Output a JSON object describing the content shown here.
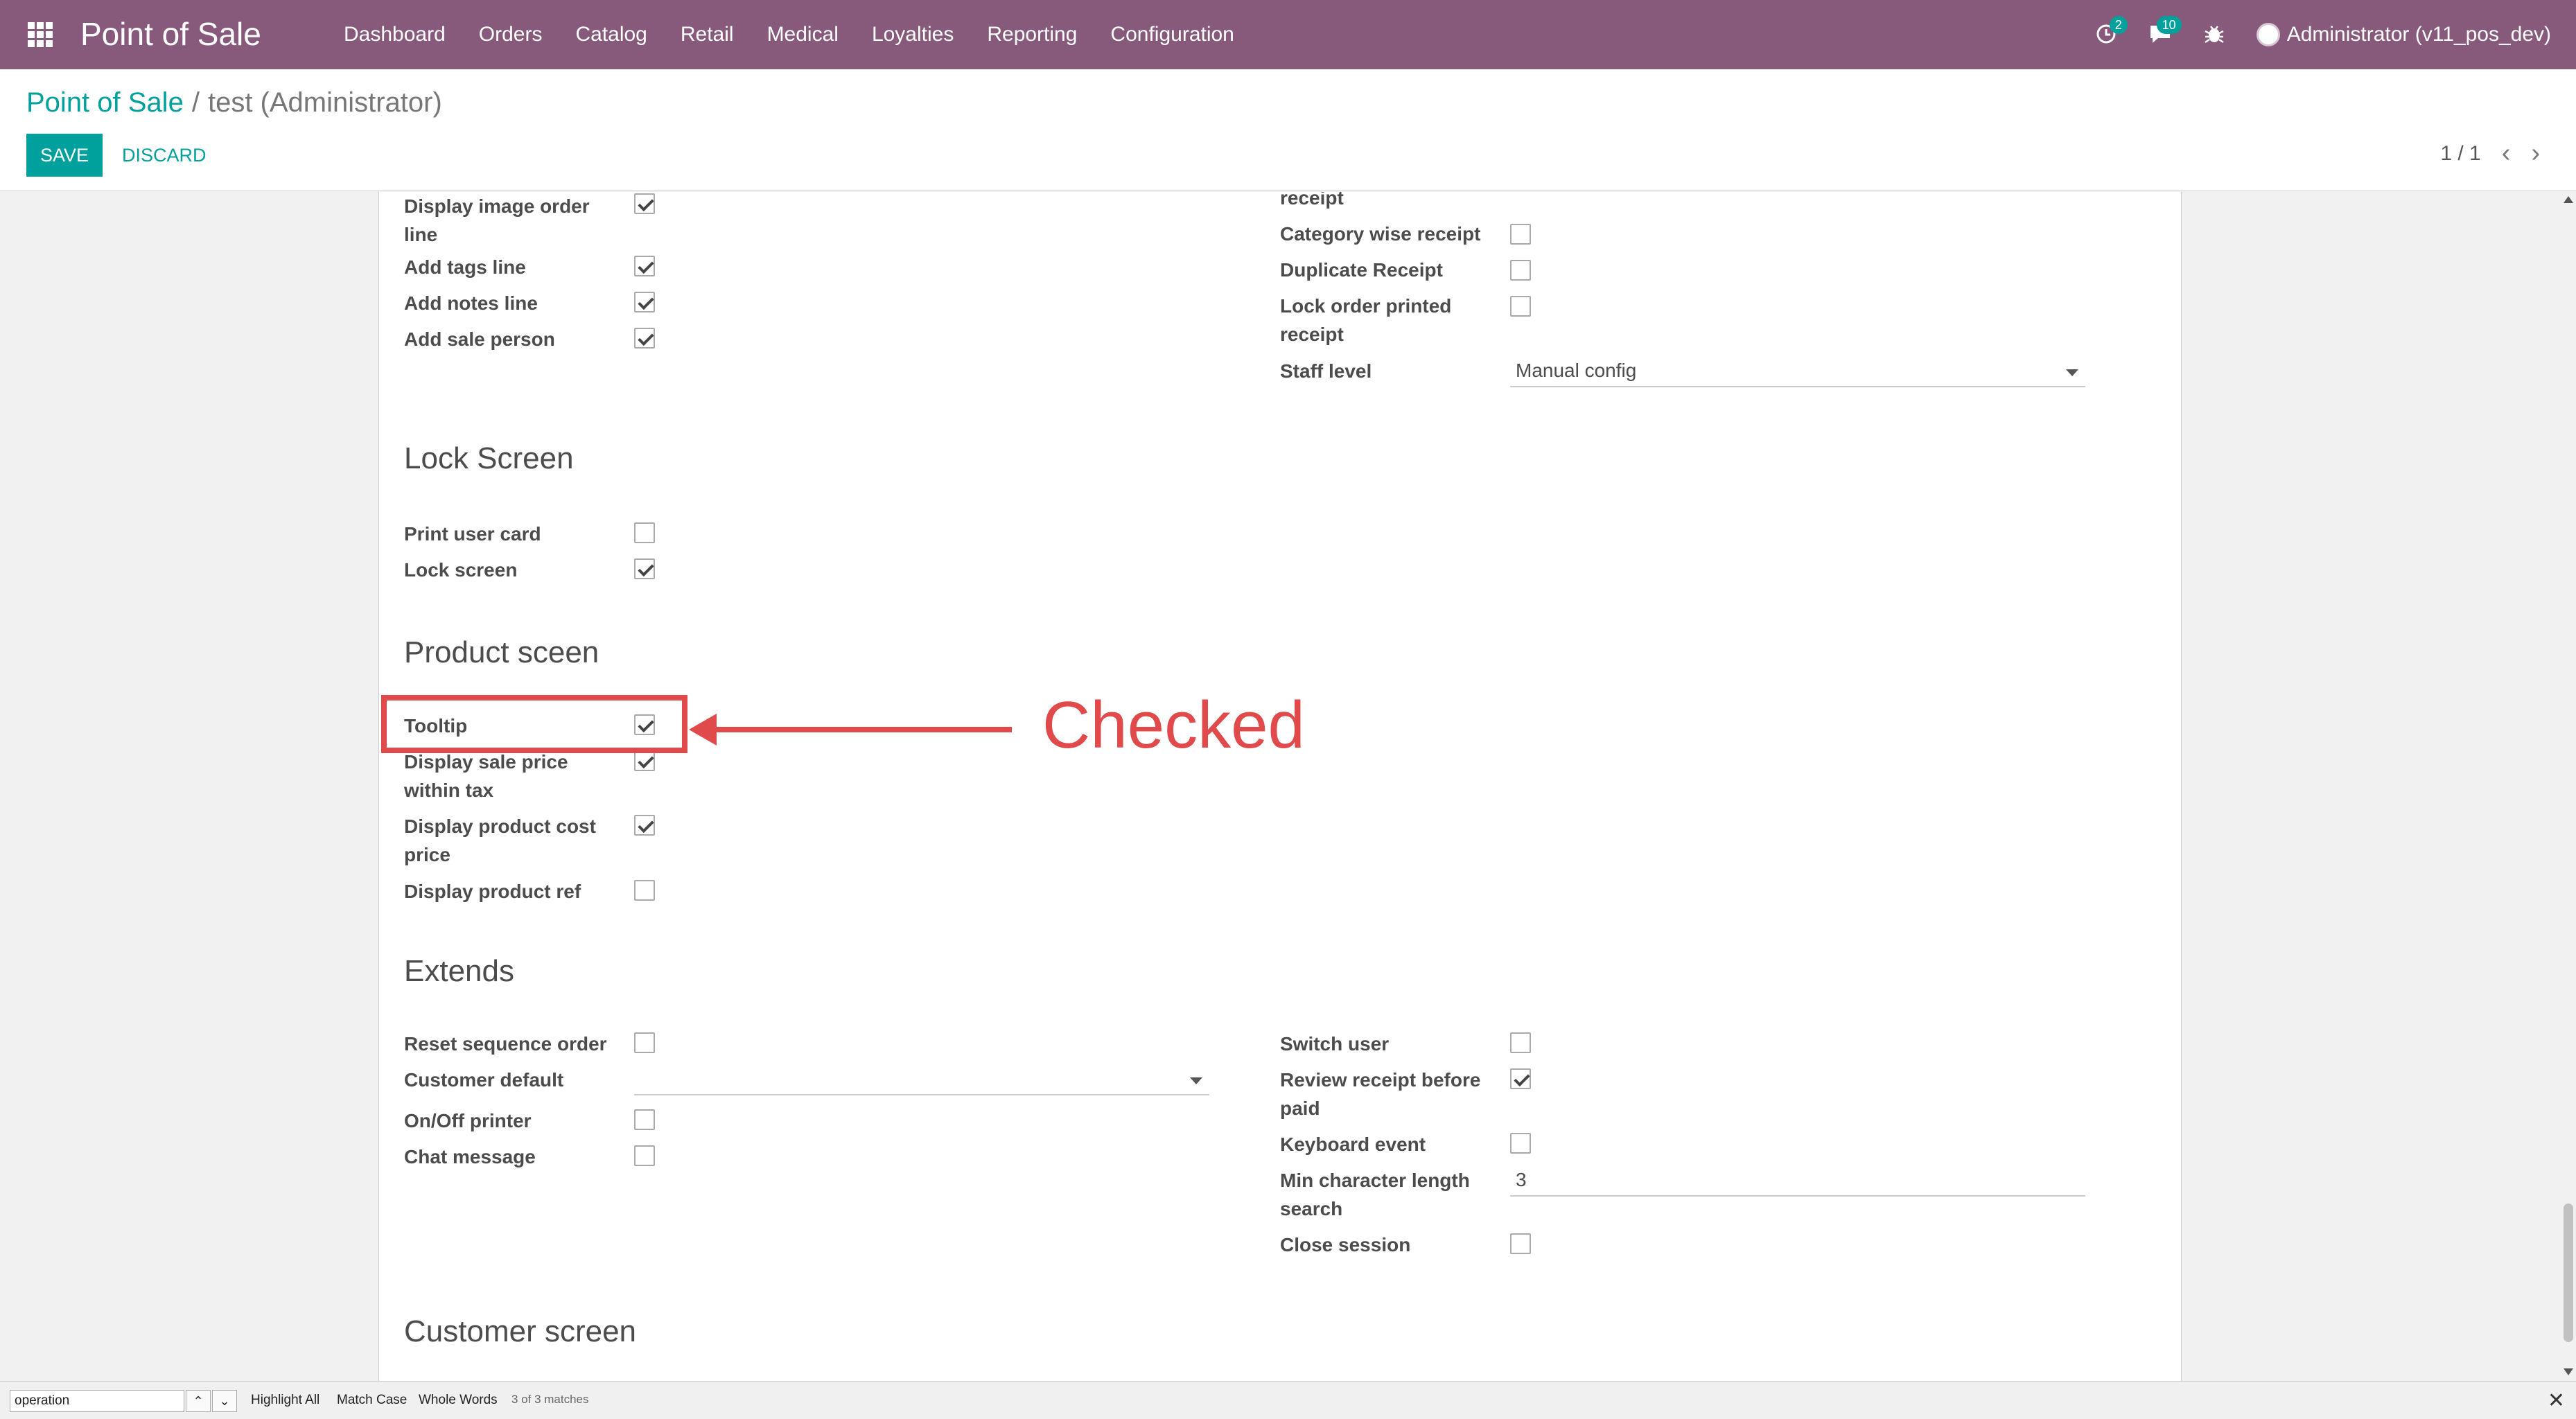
{
  "navbar": {
    "brand": "Point of Sale",
    "menu": [
      "Dashboard",
      "Orders",
      "Catalog",
      "Retail",
      "Medical",
      "Loyalties",
      "Reporting",
      "Configuration"
    ],
    "activity_badge": "2",
    "messages_badge": "10",
    "user": "Administrator (v11_pos_dev)"
  },
  "control": {
    "breadcrumb_parent": "Point of Sale",
    "breadcrumb_sep": "/",
    "breadcrumb_current": "test (Administrator)",
    "save_label": "SAVE",
    "discard_label": "DISCARD",
    "pager": "1 / 1"
  },
  "form": {
    "top_left": [
      {
        "label": "Display image order line",
        "checked": true
      },
      {
        "label": "Add tags line",
        "checked": true
      },
      {
        "label": "Add notes line",
        "checked": true
      },
      {
        "label": "Add sale person",
        "checked": true
      }
    ],
    "top_right": {
      "partial_label": "receipt",
      "category_wise_receipt": "Category wise receipt",
      "duplicate_receipt": "Duplicate Receipt",
      "lock_order_printed": "Lock order printed receipt",
      "staff_level_label": "Staff level",
      "staff_level_value": "Manual config"
    },
    "lock_screen": {
      "title": "Lock Screen",
      "print_user_card": "Print user card",
      "lock_screen": "Lock screen"
    },
    "product_screen": {
      "title": "Product sceen",
      "tooltip": "Tooltip",
      "display_sale_price": "Display sale price within tax",
      "display_cost_price": "Display product cost price",
      "display_product_ref": "Display product ref"
    },
    "extends": {
      "title": "Extends",
      "reset_sequence": "Reset sequence order",
      "customer_default": "Customer default",
      "onoff_printer": "On/Off printer",
      "chat_message": "Chat message",
      "switch_user": "Switch user",
      "review_receipt": "Review receipt before paid",
      "keyboard_event": "Keyboard event",
      "min_char_label": "Min character length search",
      "min_char_value": "3",
      "close_session": "Close session"
    },
    "customer_screen": {
      "title": "Customer screen"
    }
  },
  "annotation": {
    "text": "Checked",
    "color": "#e04a4a"
  },
  "findbar": {
    "query": "operation",
    "highlight_all": "Highlight All",
    "match_case": "Match Case",
    "whole_words": "Whole Words",
    "status": "3 of 3 matches"
  },
  "colors": {
    "navbar": "#875a7b",
    "accent": "#00a09d"
  }
}
